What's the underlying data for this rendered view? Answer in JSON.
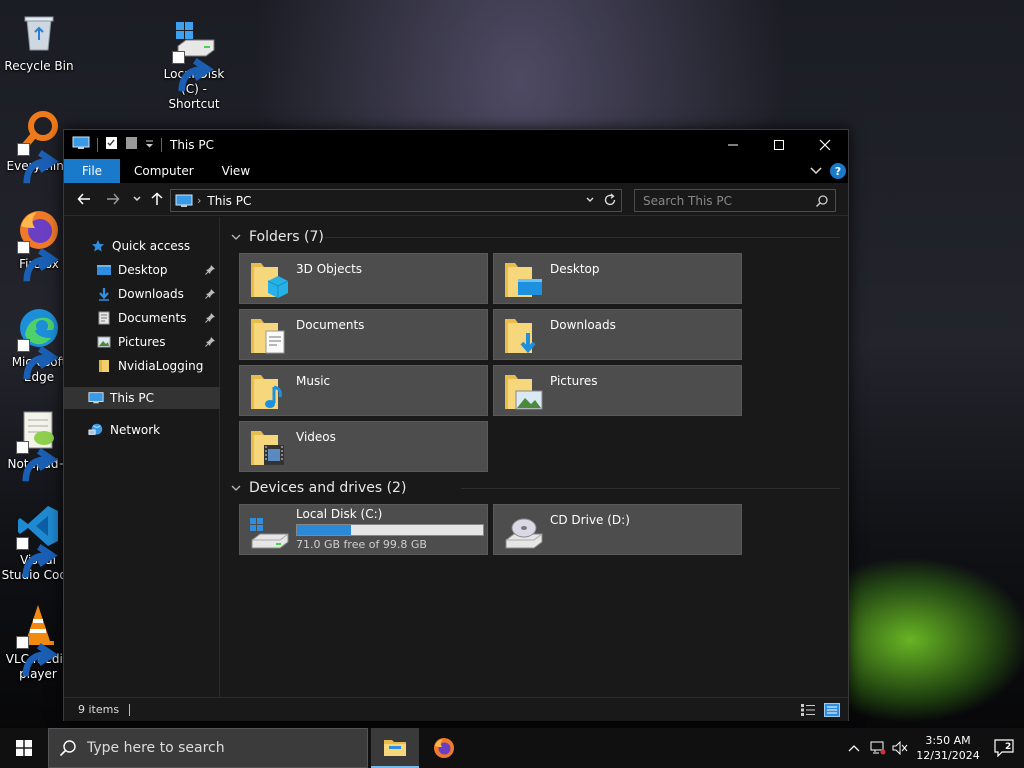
{
  "desktop": {
    "icons": [
      {
        "label": "Recycle Bin"
      },
      {
        "label": "Local Disk (C) - Shortcut"
      },
      {
        "label": "Everything"
      },
      {
        "label": "Firefox"
      },
      {
        "label": "Microsoft Edge"
      },
      {
        "label": "Notepad+"
      },
      {
        "label": "Visual Studio Code"
      },
      {
        "label": "VLC media player"
      }
    ]
  },
  "window": {
    "title": "This PC",
    "ribbon_tabs": [
      {
        "label": "File"
      },
      {
        "label": "Computer"
      },
      {
        "label": "View"
      }
    ],
    "address": {
      "crumb": "This PC"
    },
    "search": {
      "placeholder": "Search This PC"
    },
    "sidebar": {
      "items": [
        {
          "label": "Quick access"
        },
        {
          "label": "Desktop"
        },
        {
          "label": "Downloads"
        },
        {
          "label": "Documents"
        },
        {
          "label": "Pictures"
        },
        {
          "label": "NvidiaLogging"
        },
        {
          "label": "This PC"
        },
        {
          "label": "Network"
        }
      ]
    },
    "folders_header": "Folders (7)",
    "folders": [
      {
        "label": "3D Objects"
      },
      {
        "label": "Desktop"
      },
      {
        "label": "Documents"
      },
      {
        "label": "Downloads"
      },
      {
        "label": "Music"
      },
      {
        "label": "Pictures"
      },
      {
        "label": "Videos"
      }
    ],
    "devices_header": "Devices and drives (2)",
    "drives": [
      {
        "label": "Local Disk (C:)",
        "free_text": "71.0 GB free of 99.8 GB",
        "used_fraction": 0.289
      },
      {
        "label": "CD Drive (D:)"
      }
    ],
    "status": {
      "items": "9 items"
    }
  },
  "taskbar": {
    "search_placeholder": "Type here to search",
    "clock": {
      "time": "3:50 AM",
      "date": "12/31/2024"
    },
    "notification_count": "2"
  },
  "colors": {
    "accent": "#1979ca",
    "tile_bg": "#4d4d4d",
    "drive_fill": "#2a8ad7",
    "window_bg": "#191919"
  }
}
